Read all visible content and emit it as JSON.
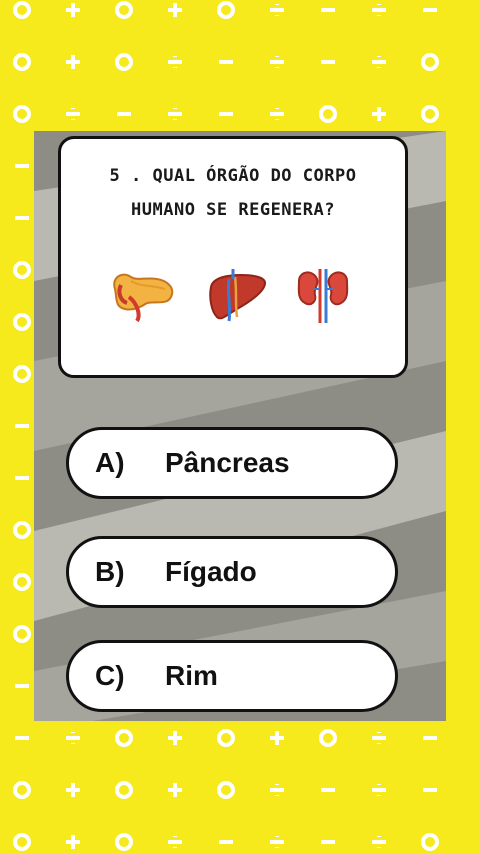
{
  "question": {
    "line1": "5 . QUAL ÓRGÃO DO CORPO",
    "line2": "HUMANO SE REGENERA?"
  },
  "organs": [
    "pancreas-icon",
    "liver-icon",
    "kidney-icon"
  ],
  "answers": [
    {
      "letter": "A)",
      "label": "Pâncreas"
    },
    {
      "letter": "B)",
      "label": "Fígado"
    },
    {
      "letter": "C)",
      "label": "Rim"
    }
  ],
  "colors": {
    "background": "#f6ea1c",
    "pattern": "#ffffff",
    "panel_gray": "#8d8d85",
    "panel_stripe": "#b9b9b1"
  }
}
